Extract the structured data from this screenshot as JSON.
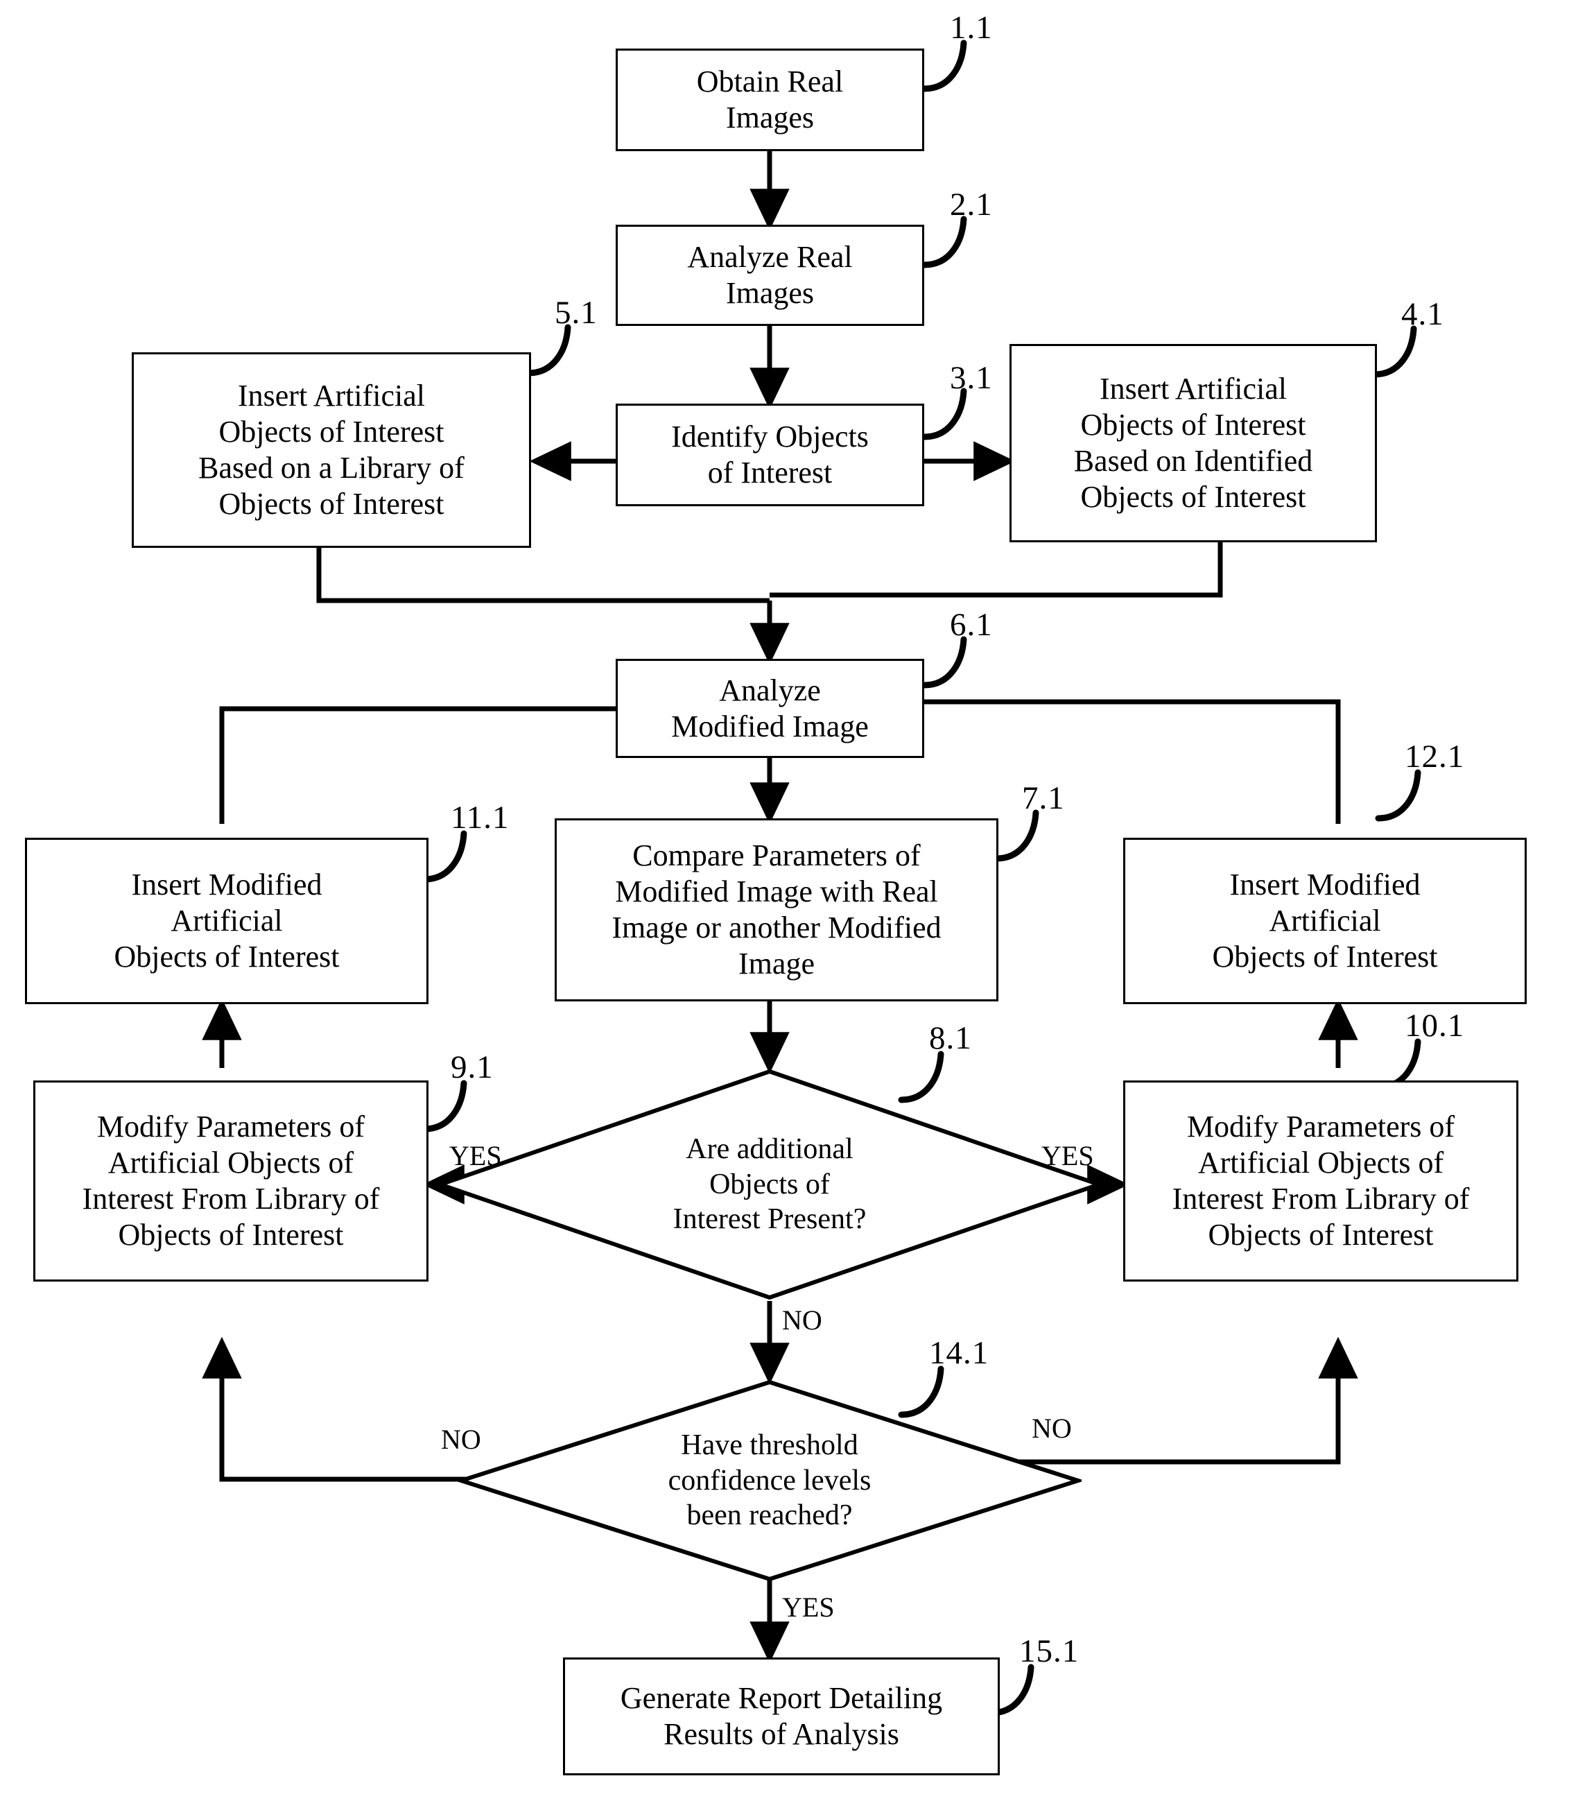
{
  "diagram": {
    "title": "Image Analysis Process Flowchart",
    "line_color": "#000000",
    "box_fill": "#ffffff"
  },
  "nodes": [
    {
      "id": "n1",
      "ref": "1.1",
      "shape": "box",
      "text": "Obtain Real\nImages"
    },
    {
      "id": "n2",
      "ref": "2.1",
      "shape": "box",
      "text": "Analyze Real\nImages"
    },
    {
      "id": "n3",
      "ref": "3.1",
      "shape": "box",
      "text": "Identify Objects\nof Interest"
    },
    {
      "id": "n4",
      "ref": "4.1",
      "shape": "box",
      "text": "Insert Artificial\nObjects of Interest\nBased on Identified\nObjects of Interest"
    },
    {
      "id": "n5",
      "ref": "5.1",
      "shape": "box",
      "text": "Insert Artificial\nObjects of Interest\nBased on a Library of\nObjects of Interest"
    },
    {
      "id": "n6",
      "ref": "6.1",
      "shape": "box",
      "text": "Analyze\nModified Image"
    },
    {
      "id": "n7",
      "ref": "7.1",
      "shape": "box",
      "text": "Compare Parameters of\nModified Image with Real\nImage or another Modified\nImage"
    },
    {
      "id": "n8",
      "ref": "8.1",
      "shape": "diamond",
      "text": "Are additional\nObjects of\nInterest Present?"
    },
    {
      "id": "n9",
      "ref": "9.1",
      "shape": "box",
      "text": "Modify Parameters of\nArtificial Objects of\nInterest From Library of\nObjects of Interest"
    },
    {
      "id": "n10",
      "ref": "10.1",
      "shape": "box",
      "text": "Modify Parameters of\nArtificial Objects of\nInterest From Library of\nObjects of Interest"
    },
    {
      "id": "n11",
      "ref": "11.1",
      "shape": "box",
      "text": "Insert Modified\nArtificial\nObjects of Interest"
    },
    {
      "id": "n12",
      "ref": "12.1",
      "shape": "box",
      "text": "Insert Modified\nArtificial\nObjects of Interest"
    },
    {
      "id": "n14",
      "ref": "14.1",
      "shape": "diamond",
      "text": "Have threshold\nconfidence levels\nbeen reached?"
    },
    {
      "id": "n15",
      "ref": "15.1",
      "shape": "box",
      "text": "Generate Report Detailing\nResults of Analysis"
    }
  ],
  "edge_labels": {
    "yes_left_8": "YES",
    "yes_right_8": "YES",
    "no_down_8": "NO",
    "no_left_14": "NO",
    "no_right_14": "NO",
    "yes_down_14": "YES"
  },
  "refs": {
    "r1": "1.1",
    "r2": "2.1",
    "r3": "3.1",
    "r4": "4.1",
    "r5": "5.1",
    "r6": "6.1",
    "r7": "7.1",
    "r8": "8.1",
    "r9": "9.1",
    "r10": "10.1",
    "r11": "11.1",
    "r12": "12.1",
    "r14": "14.1",
    "r15": "15.1"
  }
}
